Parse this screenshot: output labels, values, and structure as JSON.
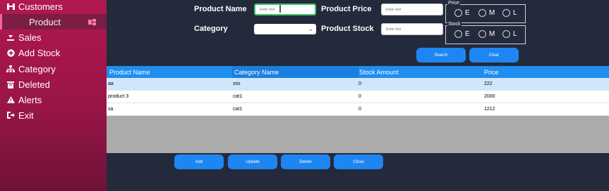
{
  "sidebar": {
    "items": [
      {
        "label": "Customers",
        "icon": "customers-icon"
      },
      {
        "label": "Product",
        "icon": "product-icon"
      },
      {
        "label": "Sales",
        "icon": "sales-icon"
      },
      {
        "label": "Add Stock",
        "icon": "plus-circle-icon"
      },
      {
        "label": "Category",
        "icon": "category-icon"
      },
      {
        "label": "Deleted",
        "icon": "trash-icon"
      },
      {
        "label": "Alerts",
        "icon": "warning-icon"
      },
      {
        "label": "Exit",
        "icon": "exit-icon"
      }
    ]
  },
  "form": {
    "product_name_label": "Product Name",
    "product_name_placeholder": "Enter text",
    "product_price_label": "Product Price",
    "product_price_placeholder": "Enter text",
    "category_label": "Category",
    "category_value": "",
    "product_stock_label": "Product Stock",
    "product_stock_placeholder": "Enter text"
  },
  "filters": {
    "price": {
      "legend": "Price",
      "options": [
        "E",
        "M",
        "L"
      ]
    },
    "stock": {
      "legend": "Stock",
      "options": [
        "E",
        "M",
        "L"
      ]
    }
  },
  "actions": {
    "search": "Search",
    "clear": "Clear",
    "add": "Add",
    "update": "Update",
    "delete": "Delete",
    "close": "Close"
  },
  "table": {
    "columns": [
      "Product Name",
      "Category Name",
      "Stock Amount",
      "Price"
    ],
    "rows": [
      [
        "aa",
        "xss",
        "0",
        "222"
      ],
      [
        "product 3",
        "cat1",
        "0",
        "2000"
      ],
      [
        "sa",
        "cat1",
        "0",
        "1212"
      ]
    ]
  },
  "colors": {
    "sidebar": "#9a1547",
    "background": "#232a3c",
    "accent": "#1e86f2",
    "header": "#1f8ef0",
    "selected_row": "#cfe6fb"
  }
}
